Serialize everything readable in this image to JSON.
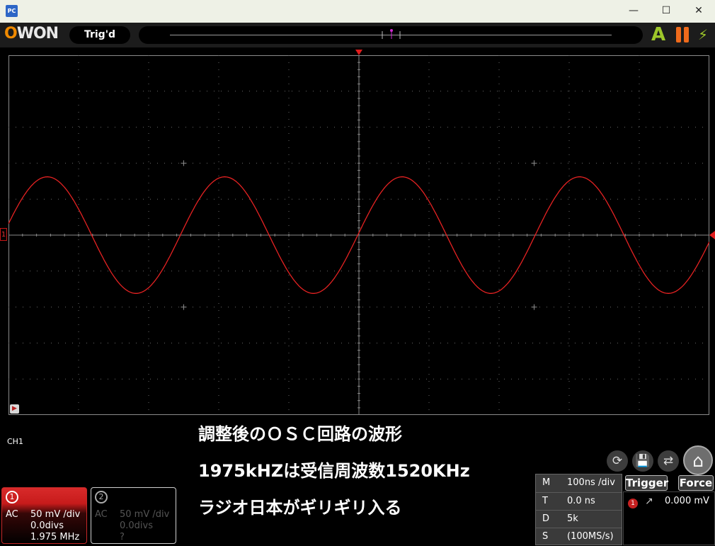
{
  "window": {
    "app_icon": "PC",
    "minimize_icon": "minimize-icon",
    "maximize_icon": "maximize-icon",
    "close_icon": "close-icon"
  },
  "toolbar": {
    "logo": "OWON",
    "trigger_status": "Trig'd",
    "acquire_mode": "A"
  },
  "screen": {
    "channel_marker": "1",
    "ch_label": "CH1",
    "waveform_color": "#e52222"
  },
  "caption": {
    "line1": "調整後のＯＳＣ回路の波形",
    "line2": "1975kHZは受信周波数1520KHz",
    "line3": "ラジオ日本がギリギリ入る"
  },
  "channels": [
    {
      "num": "1",
      "coupling": "AC",
      "scale": "50 mV /div",
      "offset": "0.0divs",
      "freq": "1.975 MHz",
      "color": "#c62828"
    },
    {
      "num": "2",
      "coupling": "AC",
      "scale": "50 mV /div",
      "offset": "0.0divs",
      "freq": "?",
      "color": "#555555"
    }
  ],
  "horizontal": {
    "rows": [
      {
        "key": "M",
        "value": "100ns /div"
      },
      {
        "key": "T",
        "value": "0.0 ns"
      },
      {
        "key": "D",
        "value": "5k"
      },
      {
        "key": "S",
        "value": "(100MS/s)"
      }
    ]
  },
  "trigger": {
    "trigger_label": "Trigger",
    "force_label": "Force",
    "source": "1",
    "level": "0.000 mV"
  },
  "chart_data": {
    "type": "line",
    "x_unit_per_div": "100ns",
    "y_unit_per_div": "50 mV",
    "x_divisions": 20,
    "y_divisions": 10,
    "xlim_ns": [
      -1000,
      1000
    ],
    "ylim_mv": [
      -250,
      250
    ],
    "frequency_mhz": 1.975,
    "amplitude_mv": 81,
    "grid": true,
    "series": [
      {
        "name": "CH1",
        "color": "#e52222",
        "x": [
          -1000,
          -950,
          -900,
          -850,
          -800,
          -750,
          -700,
          -650,
          -600,
          -550,
          -500,
          -450,
          -400,
          -350,
          -300,
          -250,
          -200,
          -150,
          -100,
          -50,
          0,
          50,
          100,
          150,
          200,
          250,
          300,
          350,
          400,
          450,
          500,
          550,
          600,
          650,
          700,
          750,
          800,
          850,
          900,
          950,
          1000
        ],
        "y": [
          26,
          67,
          81,
          53,
          -1,
          -55,
          -81,
          -65,
          -21,
          35,
          77,
          76,
          40,
          -18,
          -69,
          -80,
          -51,
          4,
          58,
          81,
          61,
          16,
          -39,
          -78,
          -74,
          -36,
          22,
          71,
          79,
          48,
          -7,
          -61,
          -81,
          -59,
          -12,
          43,
          79,
          72,
          32,
          -27,
          -73
        ]
      }
    ]
  }
}
